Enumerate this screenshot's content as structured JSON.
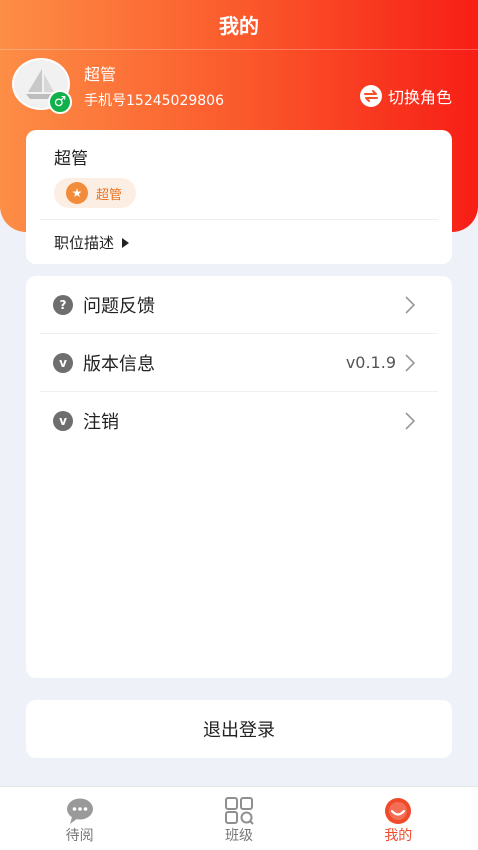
{
  "header": {
    "title": "我的"
  },
  "profile": {
    "name": "超管",
    "phone": "手机号15245029806",
    "gender_symbol": "♂",
    "switch_role_label": "切换角色"
  },
  "role_card": {
    "title": "超管",
    "chip_label": "超管",
    "chip_icon": "★",
    "description_label": "职位描述"
  },
  "menu": {
    "items": [
      {
        "icon": "?",
        "label": "问题反馈",
        "value": ""
      },
      {
        "icon": "v",
        "label": "版本信息",
        "value": "v0.1.9"
      },
      {
        "icon": "v",
        "label": "注销",
        "value": ""
      }
    ]
  },
  "logout": {
    "label": "退出登录"
  },
  "tabbar": {
    "items": [
      {
        "label": "待阅"
      },
      {
        "label": "班级"
      },
      {
        "label": "我的"
      }
    ]
  },
  "colors": {
    "header_gradient_start": "#fd8e46",
    "header_gradient_end": "#f71e16",
    "active_tab": "#f04a2a",
    "chip_bg": "#fdeee3",
    "chip_text": "#e87522",
    "gender_badge": "#10b04a",
    "page_bg": "#eef2f8"
  }
}
